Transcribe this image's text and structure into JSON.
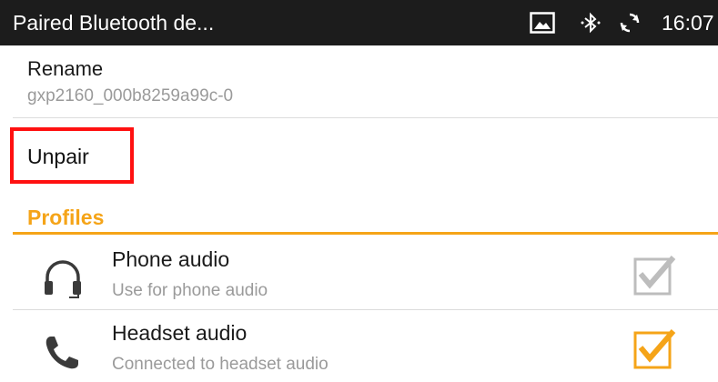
{
  "status_bar": {
    "title": "Paired Bluetooth de...",
    "time": "16:07",
    "icons": [
      "image-icon",
      "bluetooth-icon",
      "sync-icon"
    ]
  },
  "rename": {
    "title": "Rename",
    "device_name": "gxp2160_000b8259a99c-0"
  },
  "unpair": {
    "label": "Unpair"
  },
  "profiles": {
    "header": "Profiles",
    "items": [
      {
        "title": "Phone audio",
        "subtitle": "Use for phone audio",
        "icon": "headset-icon",
        "checked": true,
        "enabled": false
      },
      {
        "title": "Headset audio",
        "subtitle": "Connected to headset audio",
        "icon": "phone-icon",
        "checked": true,
        "enabled": true
      }
    ]
  },
  "colors": {
    "accent": "#f5a418",
    "highlight": "#ff1010",
    "status_bar": "#1c1c1c",
    "disabled_checkbox": "#bdbdbd"
  }
}
